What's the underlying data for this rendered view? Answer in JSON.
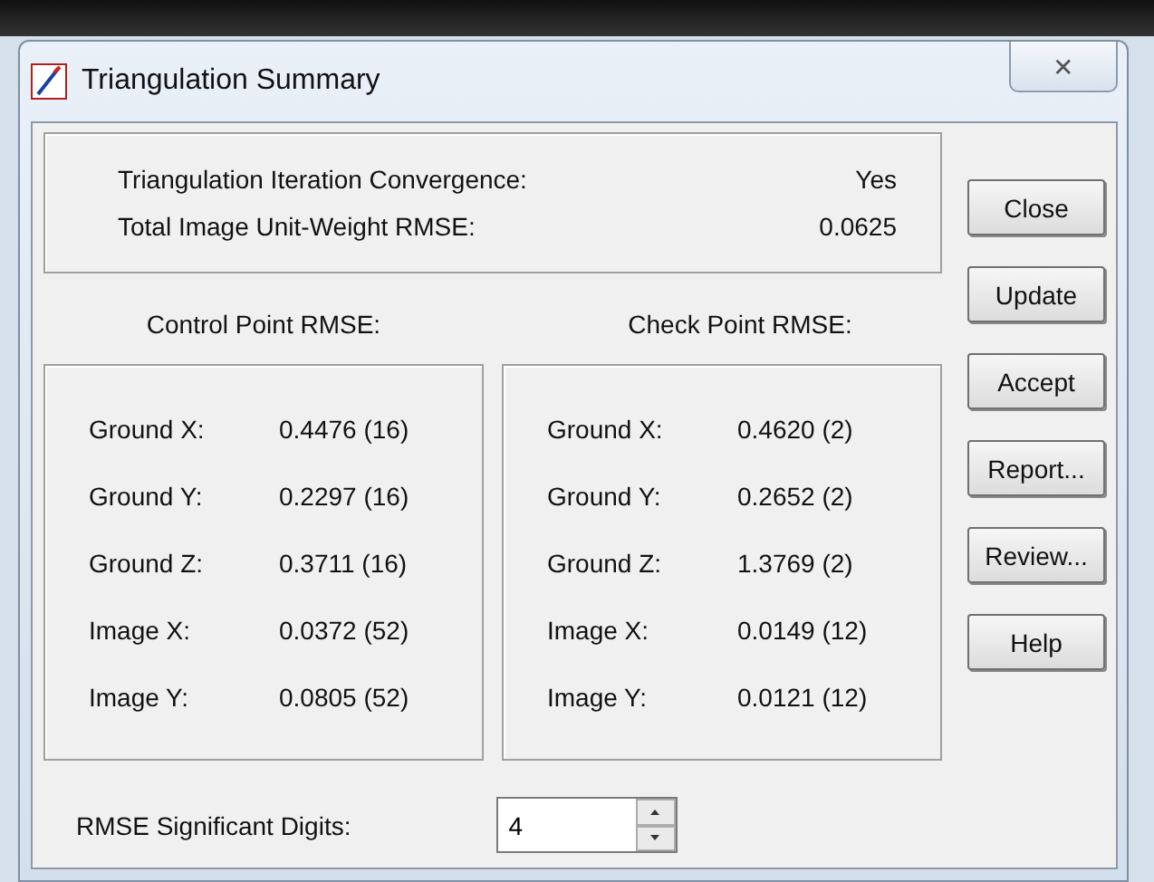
{
  "window": {
    "title": "Triangulation Summary",
    "close_glyph": "✕"
  },
  "summary": [
    {
      "label": "Triangulation Iteration Convergence:",
      "value": "Yes"
    },
    {
      "label": "Total Image Unit-Weight RMSE:",
      "value": "0.0625"
    }
  ],
  "groups": [
    {
      "heading": "Control Point RMSE:",
      "rows": [
        {
          "label": "Ground X:",
          "value": "0.4476 (16)"
        },
        {
          "label": "Ground Y:",
          "value": "0.2297 (16)"
        },
        {
          "label": "Ground Z:",
          "value": "0.3711 (16)"
        },
        {
          "label": "Image X:",
          "value": "0.0372 (52)"
        },
        {
          "label": "Image Y:",
          "value": "0.0805 (52)"
        }
      ]
    },
    {
      "heading": "Check Point RMSE:",
      "rows": [
        {
          "label": "Ground X:",
          "value": "0.4620 (2)"
        },
        {
          "label": "Ground Y:",
          "value": "0.2652 (2)"
        },
        {
          "label": "Ground Z:",
          "value": "1.3769 (2)"
        },
        {
          "label": "Image X:",
          "value": "0.0149 (12)"
        },
        {
          "label": "Image Y:",
          "value": "0.0121 (12)"
        }
      ]
    }
  ],
  "buttons": [
    "Close",
    "Update",
    "Accept",
    "Report...",
    "Review...",
    "Help"
  ],
  "digits": {
    "label": "RMSE Significant Digits:",
    "value": "4"
  }
}
